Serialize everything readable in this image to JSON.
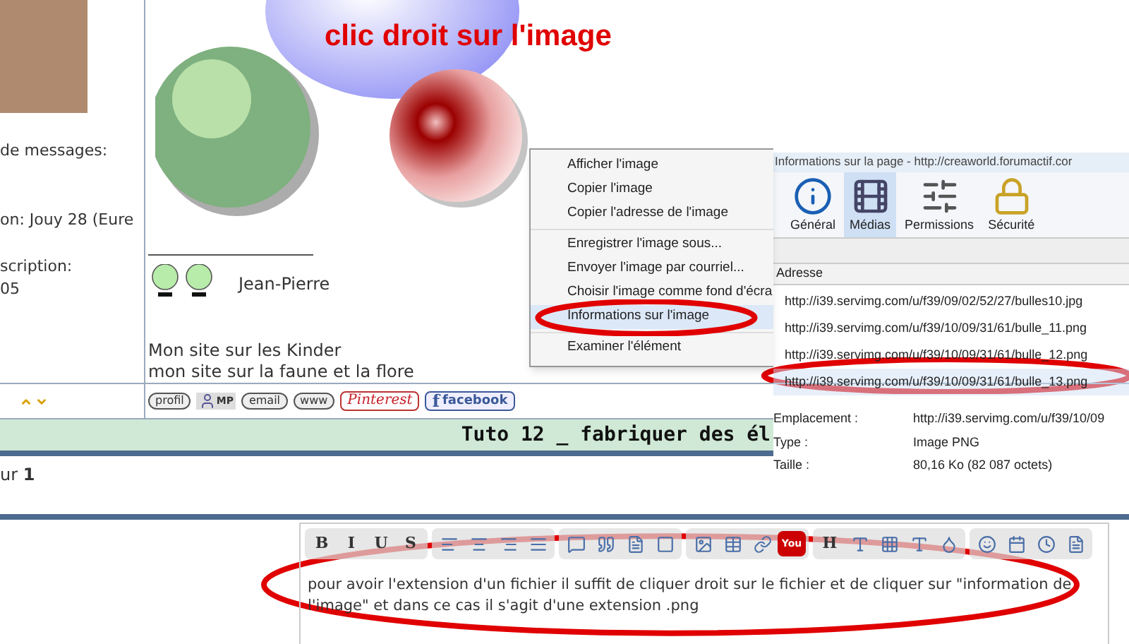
{
  "profile": {
    "lines": [
      "de messages:",
      "on: Jouy 28 (Eure",
      "scription:",
      "05"
    ]
  },
  "post": {
    "image_title": "clic droit sur l'image",
    "signature_name": "Jean-Pierre",
    "signature_lines": [
      "Mon site sur les Kinder",
      "mon site sur la faune et la flore"
    ]
  },
  "post_buttons": [
    {
      "kind": "pill",
      "label": "profil"
    },
    {
      "kind": "pm",
      "label": "MP"
    },
    {
      "kind": "pill",
      "label": "email"
    },
    {
      "kind": "pill",
      "label": "www"
    },
    {
      "kind": "pinterest",
      "label": "Pinterest"
    },
    {
      "kind": "facebook",
      "logo": "f",
      "label": "facebook"
    }
  ],
  "topic_bar": {
    "title": "Tuto 12 _ fabriquer des él"
  },
  "pagination": {
    "prefix": "ur",
    "page": "1"
  },
  "context_menu": {
    "groups": [
      [
        {
          "label": "Afficher l'image",
          "selected": false
        },
        {
          "label": "Copier l'image",
          "selected": false
        },
        {
          "label": "Copier l'adresse de l'image",
          "selected": false
        }
      ],
      [
        {
          "label": "Enregistrer l'image sous...",
          "selected": false
        },
        {
          "label": "Envoyer l'image par courriel...",
          "selected": false
        },
        {
          "label": "Choisir l'image comme fond d'écra",
          "selected": false
        },
        {
          "label": "Informations sur l'image",
          "selected": true
        }
      ],
      [
        {
          "label": "Examiner l'élément",
          "selected": false
        }
      ]
    ]
  },
  "info_window": {
    "title": "Informations sur la page - http://creaworld.forumactif.cor",
    "tabs": [
      {
        "kind": "general",
        "label": "Général",
        "selected": false
      },
      {
        "kind": "media",
        "label": "Médias",
        "selected": true
      },
      {
        "kind": "permissions",
        "label": "Permissions",
        "selected": false
      },
      {
        "kind": "security",
        "label": "Sécurité",
        "selected": false
      }
    ],
    "column": "Adresse",
    "rows": [
      {
        "url": "http://i39.servimg.com/u/f39/09/02/52/27/bulles10.jpg",
        "selected": false
      },
      {
        "url": "http://i39.servimg.com/u/f39/10/09/31/61/bulle_11.png",
        "selected": false
      },
      {
        "url": "http://i39.servimg.com/u/f39/10/09/31/61/bulle_12.png",
        "selected": false
      },
      {
        "url": "http://i39.servimg.com/u/f39/10/09/31/61/bulle_13.png",
        "selected": true
      }
    ],
    "details": [
      {
        "label": "Emplacement :",
        "value": "http://i39.servimg.com/u/f39/10/09"
      },
      {
        "label": "Type :",
        "value": "Image PNG"
      },
      {
        "label": "Taille :",
        "value": "80,16 Ko (82 087 octets)"
      }
    ]
  },
  "editor": {
    "toolbar": [
      [
        {
          "kind": "text",
          "label": "B"
        },
        {
          "kind": "text",
          "label": "I"
        },
        {
          "kind": "text",
          "label": "U"
        },
        {
          "kind": "text",
          "label": "S"
        }
      ],
      [
        {
          "kind": "icon"
        },
        {
          "kind": "icon"
        },
        {
          "kind": "icon"
        },
        {
          "kind": "icon"
        }
      ],
      [
        {
          "kind": "icon"
        },
        {
          "kind": "icon"
        },
        {
          "kind": "icon"
        },
        {
          "kind": "icon"
        }
      ],
      [
        {
          "kind": "icon"
        },
        {
          "kind": "icon"
        },
        {
          "kind": "icon"
        },
        {
          "kind": "video",
          "label": "You"
        }
      ],
      [
        {
          "kind": "text",
          "label": "H"
        },
        {
          "kind": "icon"
        },
        {
          "kind": "icon"
        },
        {
          "kind": "icon"
        },
        {
          "kind": "icon"
        }
      ],
      [
        {
          "kind": "icon"
        },
        {
          "kind": "icon"
        },
        {
          "kind": "icon"
        },
        {
          "kind": "icon"
        }
      ]
    ],
    "value": "pour avoir l'extension d'un fichier il suffit de cliquer droit sur le fichier et de cliquer sur \"information de l'image\" et dans ce cas il s'agit d'une extension .png"
  }
}
